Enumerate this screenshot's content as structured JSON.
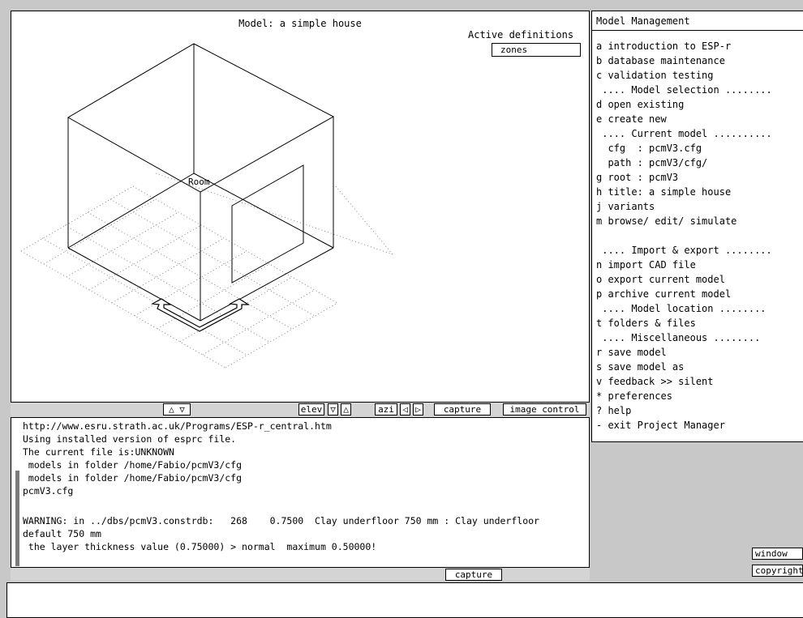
{
  "viewport": {
    "title": "Model: a simple house",
    "active_definitions_label": "Active definitions",
    "active_definitions_value": "zones",
    "zone_label": "Room"
  },
  "toolbar": {
    "updown": "△ ▽",
    "elev": "elev",
    "elev_down": "▽",
    "elev_up": "△",
    "azi": "azi",
    "azi_left": "◁",
    "azi_right": "▷",
    "capture": "capture",
    "image_control": "image control"
  },
  "text_feedback": {
    "lines": [
      "http://www.esru.strath.ac.uk/Programs/ESP-r_central.htm",
      "Using installed version of esprc file.",
      "The current file is:UNKNOWN",
      " models in folder /home/Fabio/pcmV3/cfg",
      " models in folder /home/Fabio/pcmV3/cfg",
      "pcmV3.cfg",
      "",
      "WARNING: in ../dbs/pcmV3.constrdb:   268    0.7500  Clay underfloor 750 mm : Clay underfloor",
      "default 750 mm",
      " the layer thickness value (0.75000) > normal  maximum 0.50000!"
    ],
    "capture": "capture"
  },
  "menu": {
    "title": "Model Management",
    "items": [
      "a introduction to ESP-r",
      "b database maintenance",
      "c validation testing",
      " .... Model selection ........",
      "d open existing",
      "e create new",
      " .... Current model ..........",
      "  cfg  : pcmV3.cfg",
      "  path : pcmV3/cfg/",
      "g root : pcmV3",
      "h title: a simple house",
      "j variants",
      "m browse/ edit/ simulate",
      "",
      " .... Import & export ........",
      "n import CAD file",
      "o export current model",
      "p archive current model",
      " .... Model location ........",
      "t folders & files",
      " .... Miscellaneous ........",
      "r save model",
      "s save model as",
      "v feedback >> silent",
      "* preferences",
      "? help",
      "- exit Project Manager"
    ]
  },
  "right_buttons": {
    "window": "window",
    "copyright": "copyright"
  }
}
